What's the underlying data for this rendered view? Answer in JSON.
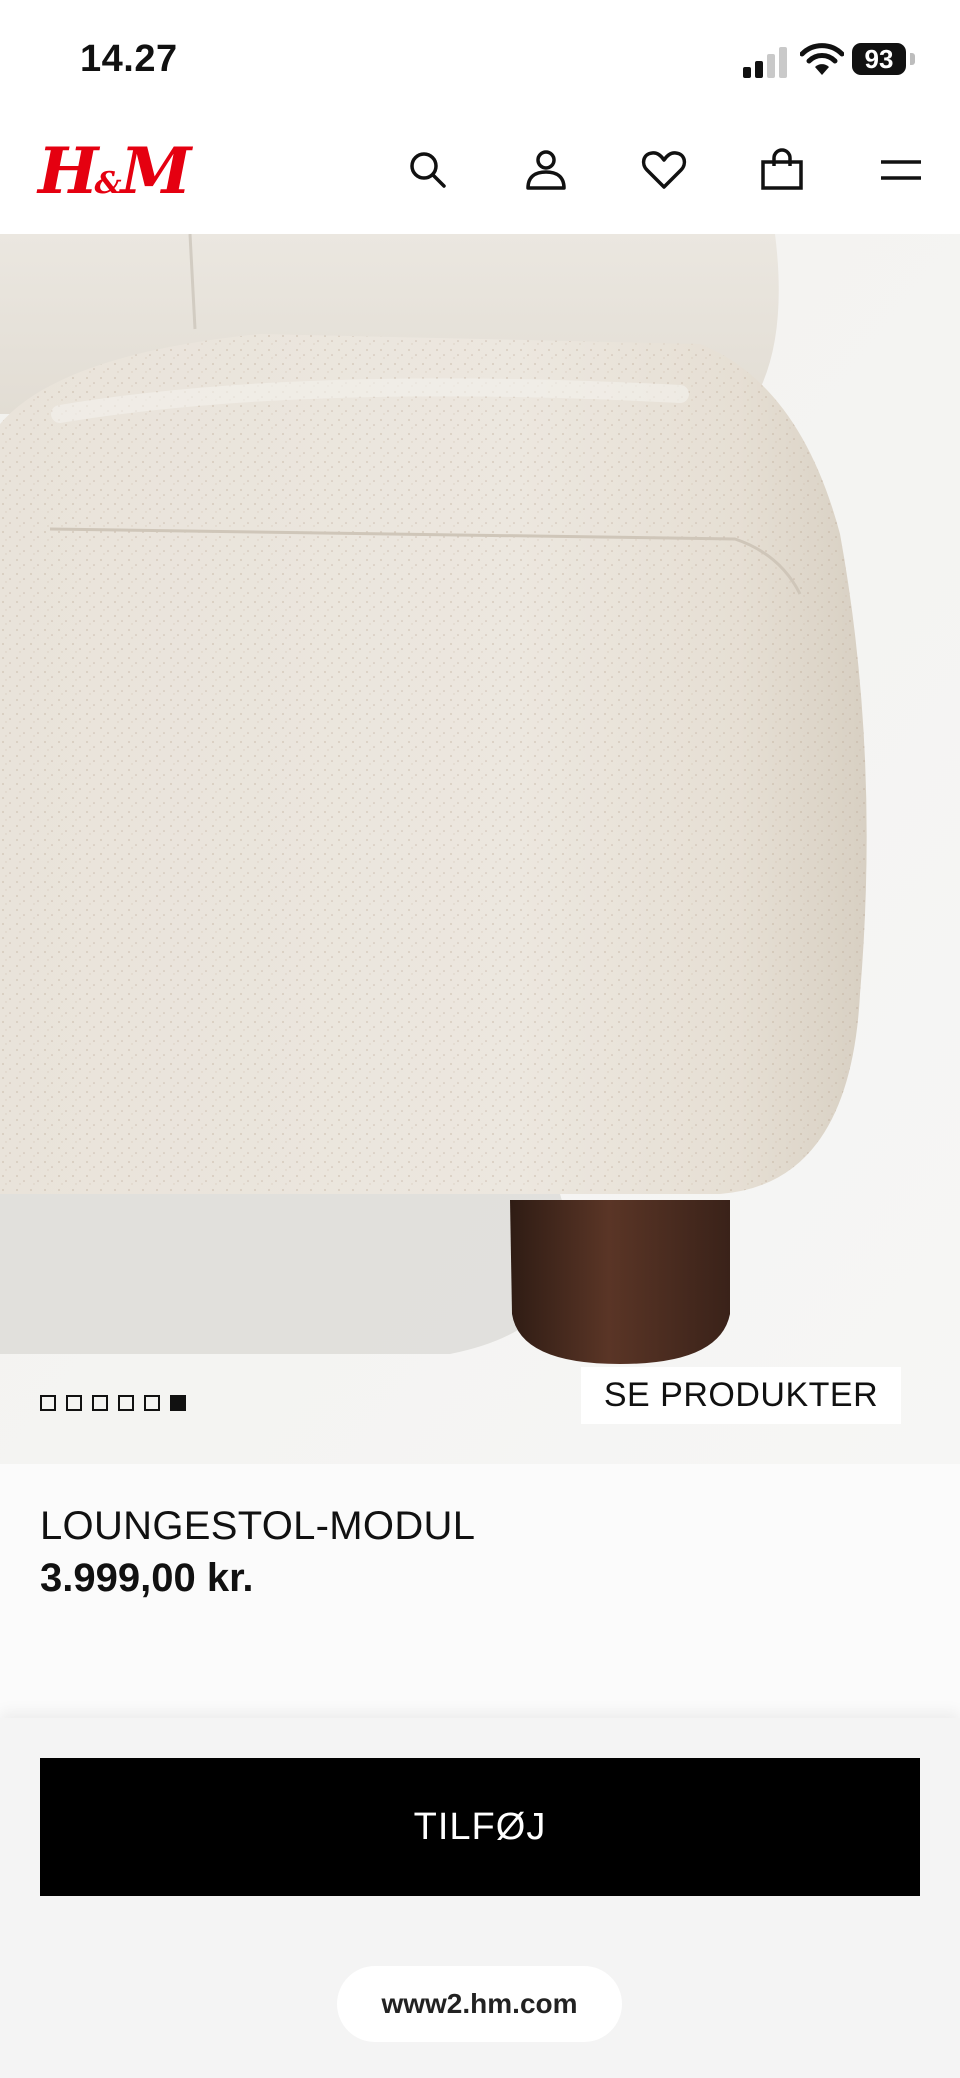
{
  "status_bar": {
    "time": "14.27",
    "battery": "93",
    "icons": [
      "cellular-signal-icon",
      "wifi-icon",
      "battery-icon"
    ]
  },
  "header": {
    "logo": "H&M",
    "brand_color": "#e50010",
    "icons": [
      "search-icon",
      "account-icon",
      "heart-icon",
      "shopping-bag-icon",
      "menu-icon"
    ]
  },
  "gallery": {
    "total_images": 6,
    "active_index": 5,
    "see_products_label": "SE PRODUKTER"
  },
  "product": {
    "name": "LOUNGESTOL-MODUL",
    "price": "3.999,00 kr."
  },
  "actions": {
    "add_label": "TILFØJ"
  },
  "browser": {
    "url": "www2.hm.com"
  }
}
